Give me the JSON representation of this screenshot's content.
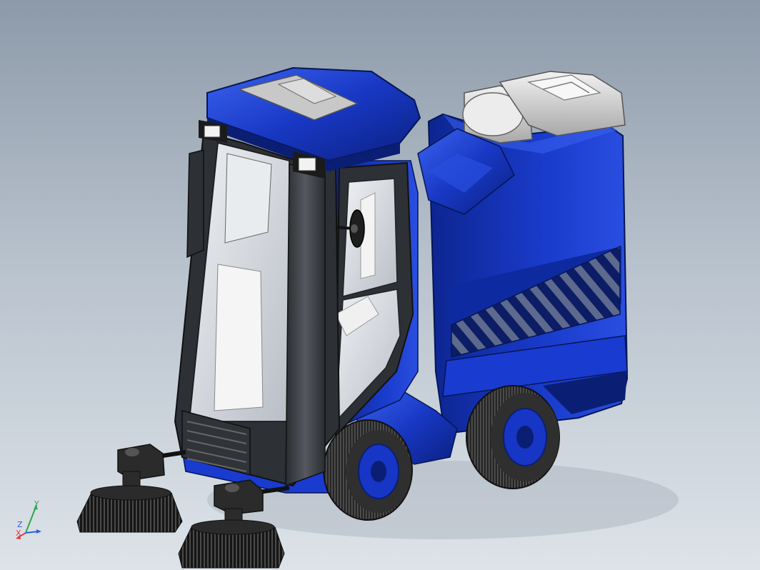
{
  "viewport": {
    "colors": {
      "body_blue": "#1234b8",
      "body_blue_light": "#3a5ee6",
      "body_blue_dark": "#0a1f73",
      "cab_frame": "#3a3d42",
      "glass": "#d9dde2",
      "hopper_grey": "#d6d6d6",
      "tire": "#2b2b2b",
      "brush": "#1e1e1e"
    },
    "icons": {
      "triad": "coordinate-triad-icon"
    }
  },
  "triad": {
    "x_label": "X",
    "y_label": "Y",
    "z_label": "Z",
    "x_color": "#e23b3b",
    "y_color": "#2fa64a",
    "z_color": "#2f5fd8"
  }
}
